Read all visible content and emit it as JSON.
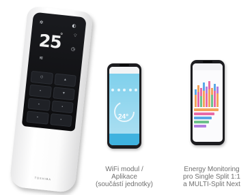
{
  "remote": {
    "temperature": "25",
    "brand": "TOSHIBA"
  },
  "phone_wifi": {
    "screen_temperature": "24°"
  },
  "captions": {
    "wifi": [
      "WiFi modul /",
      "Aplikace",
      "(součástí jednotky)"
    ],
    "energy": [
      "Energy Monitoring",
      "pro Single Split 1:1",
      "a MULTI-Split Next"
    ]
  },
  "colors": {
    "wifi_accent": "#3fb2df",
    "caption_text": "#6f6f6f"
  }
}
